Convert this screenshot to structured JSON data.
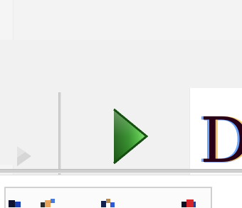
{
  "toolbar": {
    "buttons": [
      {
        "id": "prev",
        "icon": "chevron-right-icon",
        "enabled": false
      },
      {
        "id": "run",
        "icon": "play-icon",
        "enabled": true
      }
    ]
  },
  "document": {
    "visible_text": "D"
  },
  "colors": {
    "background": "#f1f1f1",
    "document_bg": "#ffffff",
    "play_green_dark": "#1f6a17",
    "play_green_light": "#7bd26c",
    "separator": "#cfcfcf",
    "disabled_arrow": "#d3d3d3",
    "text_dark": "#2a0016"
  },
  "bottom_bar": {
    "icons": [
      "status-icon",
      "user-icon",
      "tool-icon",
      "app-icon"
    ]
  }
}
